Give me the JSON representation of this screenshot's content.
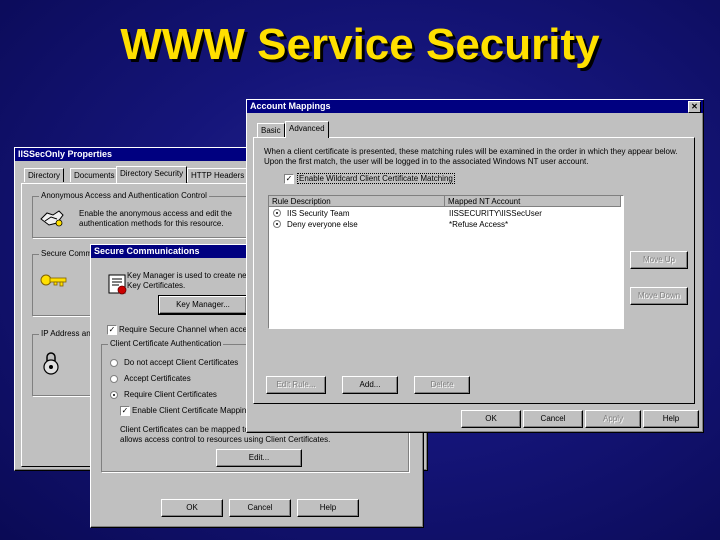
{
  "slide": {
    "title": "WWW Service Security"
  },
  "iis": {
    "title": "IISSecOnly Properties",
    "tabs": [
      "Directory",
      "Documents",
      "Directory Security",
      "HTTP Headers"
    ],
    "anon_group": "Anonymous Access and Authentication Control",
    "anon_text_1": "Enable the anonymous access and edit the",
    "anon_text_2": "authentication methods for this resource.",
    "secure_group": "Secure Communications",
    "ip_group": "IP Address and Domain Name Restrictions"
  },
  "secure": {
    "title": "Secure Communications",
    "keymgr_text_1": "Key Manager is used to create new",
    "keymgr_text_2": "Key Certificates.",
    "key_manager_button": "Key Manager...",
    "require_channel": "Require Secure Channel when access",
    "client_cert_group": "Client Certificate Authentication",
    "do_not_accept": "Do not accept Client Certificates",
    "accept": "Accept Certificates",
    "require": "Require Client Certificates",
    "enable_mapping": "Enable Client Certificate Mapping",
    "mapping_text_1": "Client Certificates can be mapped to",
    "mapping_text_2": "allows access control to resources using Client Certificates.",
    "edit_button": "Edit...",
    "ok": "OK",
    "cancel": "Cancel",
    "help": "Help"
  },
  "mappings": {
    "title": "Account Mappings",
    "close": "✕",
    "tabs": [
      "Basic",
      "Advanced"
    ],
    "desc_1": "When a client certificate is presented, these matching rules will be examined in the order in which they appear below.",
    "desc_2": "Upon the first match, the user will be logged in to the associated Windows NT user account.",
    "enable_wildcard": "Enable Wildcard Client Certificate Matching",
    "columns": [
      "Rule Description",
      "Mapped NT Account"
    ],
    "rows": [
      {
        "desc": "IIS Security Team",
        "account": "IISSECURITY\\IISSecUser"
      },
      {
        "desc": "Deny everyone else",
        "account": "*Refuse Access*"
      }
    ],
    "move_up": "Move Up",
    "move_down": "Move Down",
    "edit_rule": "Edit Rule...",
    "add": "Add...",
    "delete": "Delete",
    "ok": "OK",
    "cancel": "Cancel",
    "apply": "Apply",
    "help": "Help"
  }
}
